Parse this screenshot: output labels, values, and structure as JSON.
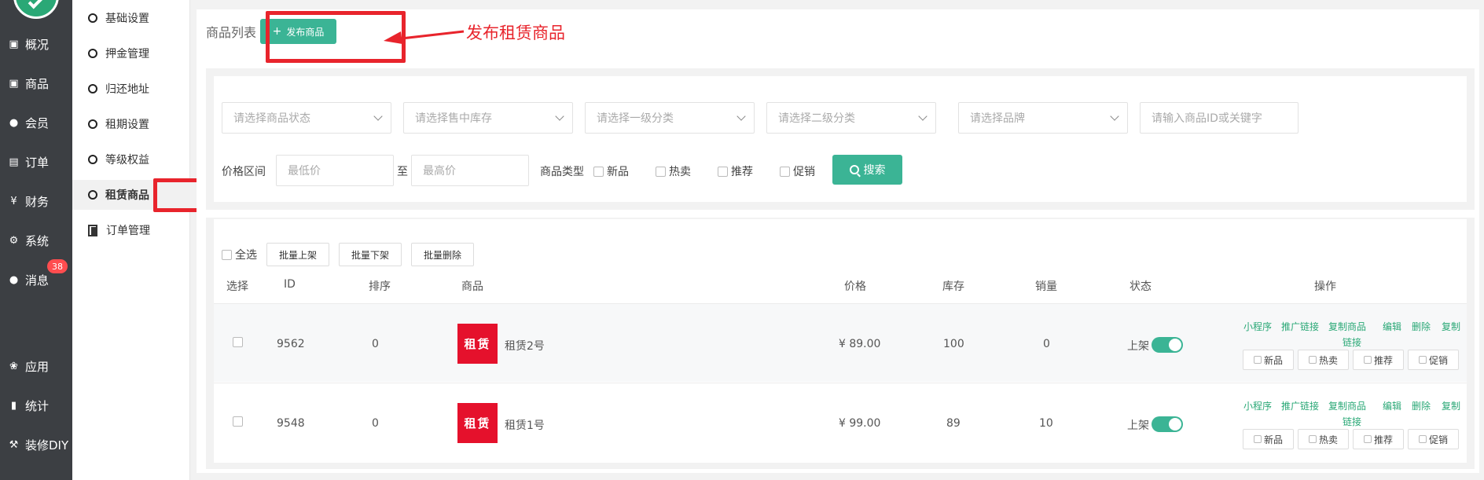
{
  "nav": {
    "items": [
      {
        "label": "概况",
        "icon": "box-icon"
      },
      {
        "label": "商品",
        "icon": "box-icon"
      },
      {
        "label": "会员",
        "icon": "users-icon"
      },
      {
        "label": "订单",
        "icon": "cart-icon"
      },
      {
        "label": "财务",
        "icon": "yen-icon"
      },
      {
        "label": "系统",
        "icon": "gears-icon"
      },
      {
        "label": "消息",
        "icon": "chat-icon"
      },
      {
        "label": "应用",
        "icon": "apps-icon"
      },
      {
        "label": "统计",
        "icon": "bar-chart-icon"
      },
      {
        "label": "装修DIY",
        "icon": "hammer-icon"
      }
    ],
    "message_badge": "38"
  },
  "submenu": {
    "items": [
      {
        "label": "基础设置"
      },
      {
        "label": "押金管理"
      },
      {
        "label": "归还地址"
      },
      {
        "label": "租期设置"
      },
      {
        "label": "等级权益"
      },
      {
        "label": "租赁商品"
      },
      {
        "label": "订单管理"
      }
    ]
  },
  "header": {
    "title": "商品列表",
    "publish_button": "发布商品",
    "annotation": "发布租赁商品"
  },
  "filters": {
    "status_placeholder": "请选择商品状态",
    "stock_placeholder": "请选择售中库存",
    "cat1_placeholder": "请选择一级分类",
    "cat2_placeholder": "请选择二级分类",
    "brand_placeholder": "请选择品牌",
    "keyword_placeholder": "请输入商品ID或关键字",
    "price_label": "价格区间",
    "min_placeholder": "最低价",
    "to_label": "至",
    "max_placeholder": "最高价",
    "type_label": "商品类型",
    "types": [
      "新品",
      "热卖",
      "推荐",
      "促销"
    ],
    "search_button": "搜索"
  },
  "bulk": {
    "select_all": "全选",
    "on_shelf": "批量上架",
    "off_shelf": "批量下架",
    "delete": "批量删除"
  },
  "table": {
    "headers": {
      "select": "选择",
      "id": "ID",
      "sort": "排序",
      "product": "商品",
      "price": "价格",
      "stock": "库存",
      "sales": "销量",
      "status": "状态",
      "actions": "操作"
    },
    "rows": [
      {
        "id": "9562",
        "sort": "0",
        "thumb": "租赁",
        "name": "租赁2号",
        "price": "¥ 89.00",
        "stock": "100",
        "sales": "0",
        "status": "上架"
      },
      {
        "id": "9548",
        "sort": "0",
        "thumb": "租赁",
        "name": "租赁1号",
        "price": "¥ 99.00",
        "stock": "89",
        "sales": "10",
        "status": "上架"
      }
    ],
    "action_links": {
      "miniprogram": "小程序",
      "promo_link": "推广链接",
      "copy_product": "复制商品",
      "edit": "编辑",
      "delete": "删除",
      "copy_link_1": "复制",
      "copy_link_2": "链接"
    },
    "tags": [
      "新品",
      "热卖",
      "推荐",
      "促销"
    ]
  },
  "colors": {
    "accent": "#3bb495",
    "annotation": "#e8242c",
    "nav_bg": "#3c3f43",
    "badge": "#ff4d4f"
  }
}
